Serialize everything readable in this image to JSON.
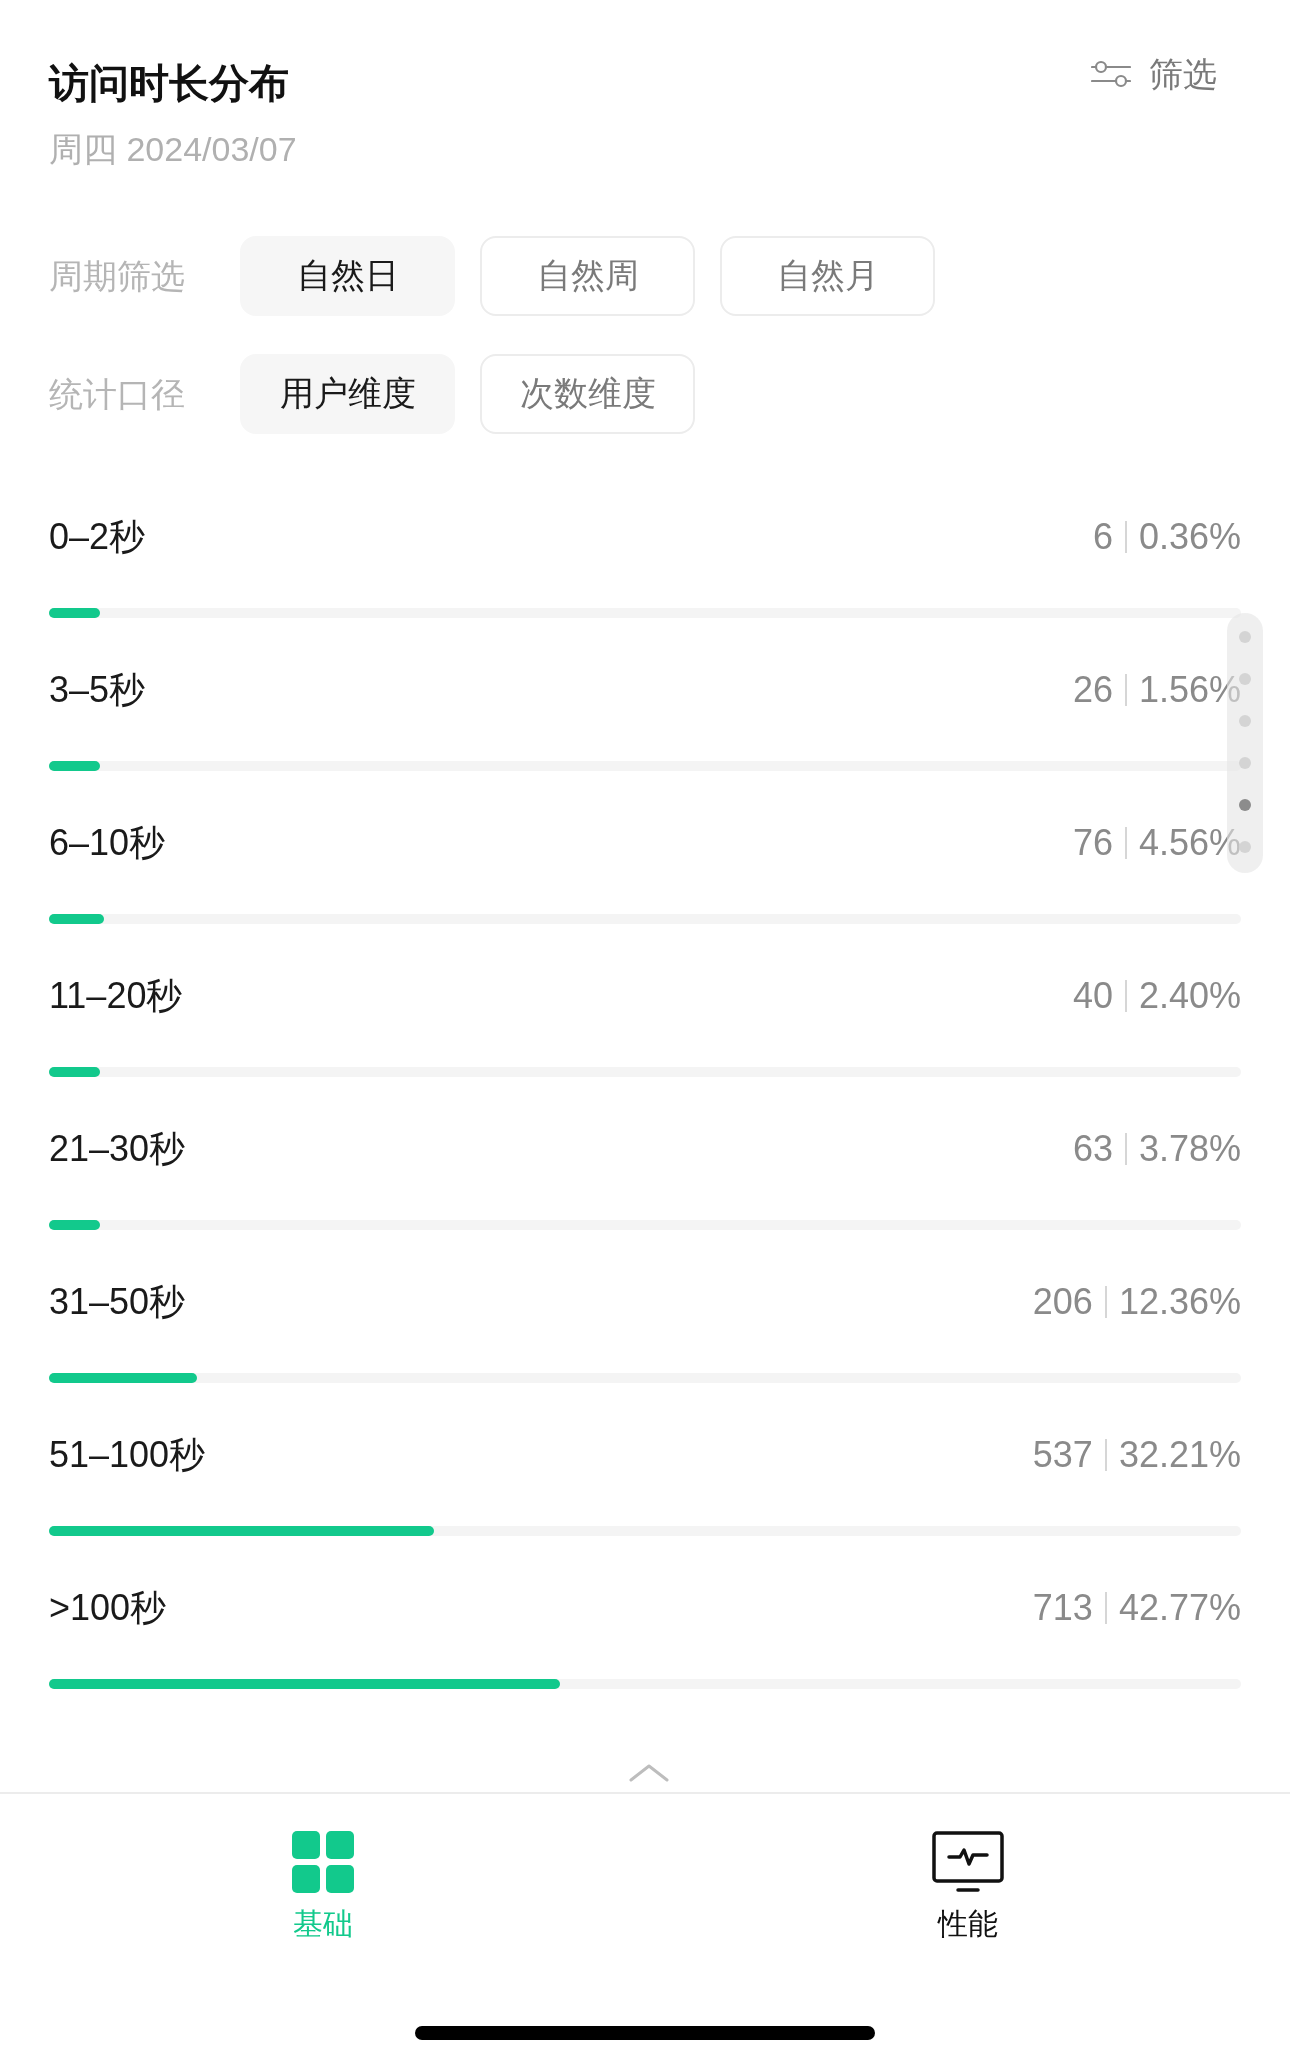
{
  "header": {
    "title": "访问时长分布",
    "date": "周四 2024/03/07",
    "filter_button": {
      "label": "筛选"
    }
  },
  "filters": [
    {
      "label": "周期筛选",
      "options": [
        {
          "label": "自然日",
          "selected": true
        },
        {
          "label": "自然周",
          "selected": false
        },
        {
          "label": "自然月",
          "selected": false
        }
      ]
    },
    {
      "label": "统计口径",
      "options": [
        {
          "label": "用户维度",
          "selected": true
        },
        {
          "label": "次数维度",
          "selected": false
        }
      ]
    }
  ],
  "distribution": [
    {
      "range": "0–2秒",
      "count": "6",
      "percent": "0.36%",
      "level": 0.043
    },
    {
      "range": "3–5秒",
      "count": "26",
      "percent": "1.56%",
      "level": 0.043
    },
    {
      "range": "6–10秒",
      "count": "76",
      "percent": "4.56%",
      "level": 0.046
    },
    {
      "range": "11–20秒",
      "count": "40",
      "percent": "2.40%",
      "level": 0.043
    },
    {
      "range": "21–30秒",
      "count": "63",
      "percent": "3.78%",
      "level": 0.043
    },
    {
      "range": "31–50秒",
      "count": "206",
      "percent": "12.36%",
      "level": 0.124
    },
    {
      "range": "51–100秒",
      "count": "537",
      "percent": "32.21%",
      "level": 0.323
    },
    {
      "range": ">100秒",
      "count": "713",
      "percent": "42.77%",
      "level": 0.429
    }
  ],
  "page_indicator": {
    "dots": [
      {
        "selected": false
      },
      {
        "selected": false
      },
      {
        "selected": false
      },
      {
        "selected": false
      },
      {
        "selected": true
      },
      {
        "selected": false
      }
    ]
  },
  "bottom_tabs": [
    {
      "label": "基础",
      "selected": true
    },
    {
      "label": "性能",
      "selected": false
    }
  ]
}
